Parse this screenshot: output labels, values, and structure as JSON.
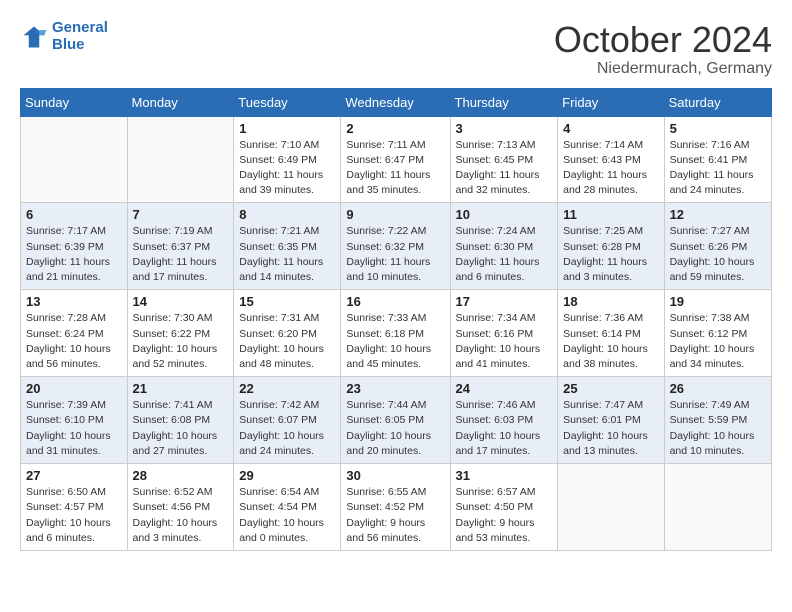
{
  "header": {
    "logo_line1": "General",
    "logo_line2": "Blue",
    "month": "October 2024",
    "location": "Niedermurach, Germany"
  },
  "weekdays": [
    "Sunday",
    "Monday",
    "Tuesday",
    "Wednesday",
    "Thursday",
    "Friday",
    "Saturday"
  ],
  "weeks": [
    [
      {
        "day": "",
        "detail": ""
      },
      {
        "day": "",
        "detail": ""
      },
      {
        "day": "1",
        "detail": "Sunrise: 7:10 AM\nSunset: 6:49 PM\nDaylight: 11 hours and 39 minutes."
      },
      {
        "day": "2",
        "detail": "Sunrise: 7:11 AM\nSunset: 6:47 PM\nDaylight: 11 hours and 35 minutes."
      },
      {
        "day": "3",
        "detail": "Sunrise: 7:13 AM\nSunset: 6:45 PM\nDaylight: 11 hours and 32 minutes."
      },
      {
        "day": "4",
        "detail": "Sunrise: 7:14 AM\nSunset: 6:43 PM\nDaylight: 11 hours and 28 minutes."
      },
      {
        "day": "5",
        "detail": "Sunrise: 7:16 AM\nSunset: 6:41 PM\nDaylight: 11 hours and 24 minutes."
      }
    ],
    [
      {
        "day": "6",
        "detail": "Sunrise: 7:17 AM\nSunset: 6:39 PM\nDaylight: 11 hours and 21 minutes."
      },
      {
        "day": "7",
        "detail": "Sunrise: 7:19 AM\nSunset: 6:37 PM\nDaylight: 11 hours and 17 minutes."
      },
      {
        "day": "8",
        "detail": "Sunrise: 7:21 AM\nSunset: 6:35 PM\nDaylight: 11 hours and 14 minutes."
      },
      {
        "day": "9",
        "detail": "Sunrise: 7:22 AM\nSunset: 6:32 PM\nDaylight: 11 hours and 10 minutes."
      },
      {
        "day": "10",
        "detail": "Sunrise: 7:24 AM\nSunset: 6:30 PM\nDaylight: 11 hours and 6 minutes."
      },
      {
        "day": "11",
        "detail": "Sunrise: 7:25 AM\nSunset: 6:28 PM\nDaylight: 11 hours and 3 minutes."
      },
      {
        "day": "12",
        "detail": "Sunrise: 7:27 AM\nSunset: 6:26 PM\nDaylight: 10 hours and 59 minutes."
      }
    ],
    [
      {
        "day": "13",
        "detail": "Sunrise: 7:28 AM\nSunset: 6:24 PM\nDaylight: 10 hours and 56 minutes."
      },
      {
        "day": "14",
        "detail": "Sunrise: 7:30 AM\nSunset: 6:22 PM\nDaylight: 10 hours and 52 minutes."
      },
      {
        "day": "15",
        "detail": "Sunrise: 7:31 AM\nSunset: 6:20 PM\nDaylight: 10 hours and 48 minutes."
      },
      {
        "day": "16",
        "detail": "Sunrise: 7:33 AM\nSunset: 6:18 PM\nDaylight: 10 hours and 45 minutes."
      },
      {
        "day": "17",
        "detail": "Sunrise: 7:34 AM\nSunset: 6:16 PM\nDaylight: 10 hours and 41 minutes."
      },
      {
        "day": "18",
        "detail": "Sunrise: 7:36 AM\nSunset: 6:14 PM\nDaylight: 10 hours and 38 minutes."
      },
      {
        "day": "19",
        "detail": "Sunrise: 7:38 AM\nSunset: 6:12 PM\nDaylight: 10 hours and 34 minutes."
      }
    ],
    [
      {
        "day": "20",
        "detail": "Sunrise: 7:39 AM\nSunset: 6:10 PM\nDaylight: 10 hours and 31 minutes."
      },
      {
        "day": "21",
        "detail": "Sunrise: 7:41 AM\nSunset: 6:08 PM\nDaylight: 10 hours and 27 minutes."
      },
      {
        "day": "22",
        "detail": "Sunrise: 7:42 AM\nSunset: 6:07 PM\nDaylight: 10 hours and 24 minutes."
      },
      {
        "day": "23",
        "detail": "Sunrise: 7:44 AM\nSunset: 6:05 PM\nDaylight: 10 hours and 20 minutes."
      },
      {
        "day": "24",
        "detail": "Sunrise: 7:46 AM\nSunset: 6:03 PM\nDaylight: 10 hours and 17 minutes."
      },
      {
        "day": "25",
        "detail": "Sunrise: 7:47 AM\nSunset: 6:01 PM\nDaylight: 10 hours and 13 minutes."
      },
      {
        "day": "26",
        "detail": "Sunrise: 7:49 AM\nSunset: 5:59 PM\nDaylight: 10 hours and 10 minutes."
      }
    ],
    [
      {
        "day": "27",
        "detail": "Sunrise: 6:50 AM\nSunset: 4:57 PM\nDaylight: 10 hours and 6 minutes."
      },
      {
        "day": "28",
        "detail": "Sunrise: 6:52 AM\nSunset: 4:56 PM\nDaylight: 10 hours and 3 minutes."
      },
      {
        "day": "29",
        "detail": "Sunrise: 6:54 AM\nSunset: 4:54 PM\nDaylight: 10 hours and 0 minutes."
      },
      {
        "day": "30",
        "detail": "Sunrise: 6:55 AM\nSunset: 4:52 PM\nDaylight: 9 hours and 56 minutes."
      },
      {
        "day": "31",
        "detail": "Sunrise: 6:57 AM\nSunset: 4:50 PM\nDaylight: 9 hours and 53 minutes."
      },
      {
        "day": "",
        "detail": ""
      },
      {
        "day": "",
        "detail": ""
      }
    ]
  ]
}
